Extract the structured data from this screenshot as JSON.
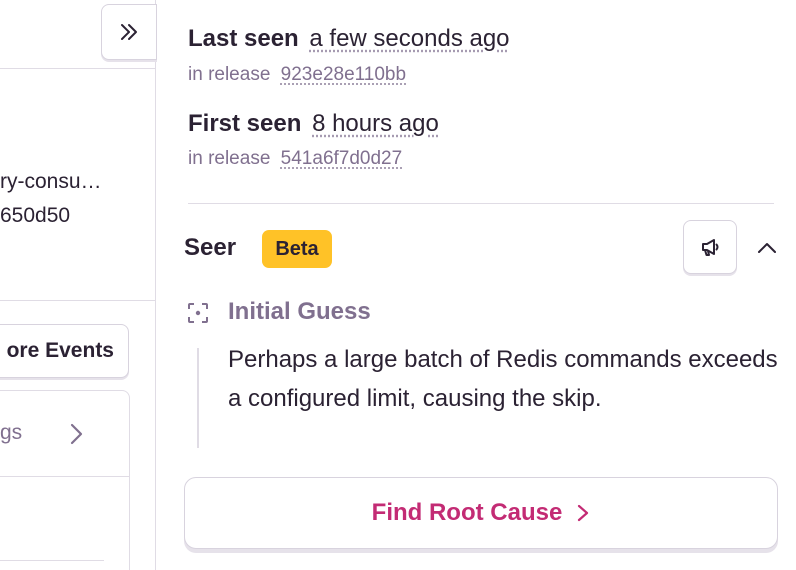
{
  "left_pane": {
    "line1": "ry-consu…",
    "line2": "650d50",
    "events_button_label": "ore Events",
    "panel_label": "gs"
  },
  "sidebar": {
    "last_seen": {
      "label": "Last seen",
      "relative": "a few seconds ago",
      "release_prefix": "in release",
      "release": "923e28e110bb"
    },
    "first_seen": {
      "label": "First seen",
      "relative": "8 hours ago",
      "release_prefix": "in release",
      "release": "541a6f7d0d27"
    },
    "seer": {
      "title": "Seer",
      "badge": "Beta",
      "feedback_icon": "megaphone-icon",
      "collapse_icon": "chevron-up-icon",
      "initial_guess": {
        "icon": "focus-icon",
        "title": "Initial Guess",
        "text": "Perhaps a large batch of Redis commands exceeds a configured limit, causing the skip."
      },
      "root_cause_button": "Find Root Cause"
    }
  },
  "colors": {
    "text": "#2b2233",
    "muted": "#80708f",
    "accent": "#c32b74",
    "badge": "#ffc227",
    "border": "#e0dce5"
  }
}
